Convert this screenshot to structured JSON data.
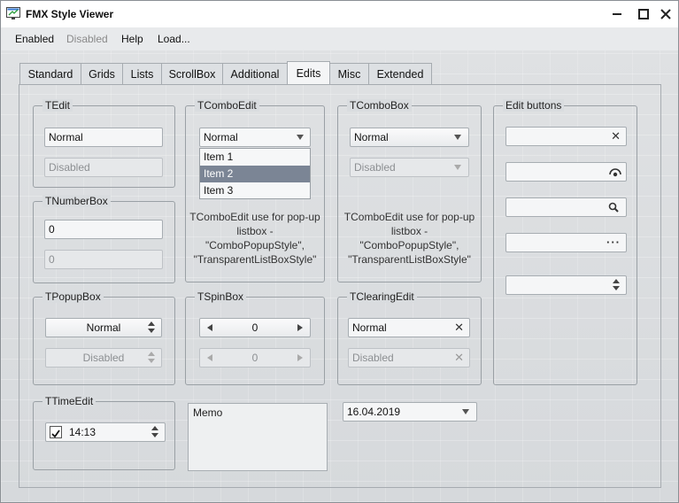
{
  "window": {
    "title": "FMX Style Viewer"
  },
  "menu": [
    "Enabled",
    "Disabled",
    "Help",
    "Load..."
  ],
  "tabs": [
    "Standard",
    "Grids",
    "Lists",
    "ScrollBox",
    "Additional",
    "Edits",
    "Misc",
    "Extended"
  ],
  "active_tab": "Edits",
  "tedit": {
    "title": "TEdit",
    "normal": "Normal",
    "disabled": "Disabled"
  },
  "tcomboedit": {
    "title": "TComboEdit",
    "value": "Normal",
    "items": [
      "Item 1",
      "Item 2",
      "Item 3"
    ],
    "selected_item": "Item 2",
    "note": [
      "TComboEdit use for pop-up",
      "listbox -",
      "\"ComboPopupStyle\",",
      "\"TransparentListBoxStyle\""
    ]
  },
  "tcombobox": {
    "title": "TComboBox",
    "normal": "Normal",
    "disabled": "Disabled",
    "note": [
      "TComboEdit use for pop-up",
      "listbox -",
      "\"ComboPopupStyle\",",
      "\"TransparentListBoxStyle\""
    ]
  },
  "edit_buttons": {
    "title": "Edit buttons"
  },
  "tnumberbox": {
    "title": "TNumberBox",
    "normal": "0",
    "disabled": "0"
  },
  "tpopupbox": {
    "title": "TPopupBox",
    "normal": "Normal",
    "disabled": "Disabled"
  },
  "tspinbox": {
    "title": "TSpinBox",
    "normal": "0",
    "disabled": "0"
  },
  "tclearingedit": {
    "title": "TClearingEdit",
    "normal": "Normal",
    "disabled": "Disabled"
  },
  "ttimeedit": {
    "title": "TTimeEdit",
    "value": "14:13",
    "checked": true
  },
  "memo": {
    "text": "Memo"
  },
  "dateedit": {
    "value": "16.04.2019"
  }
}
